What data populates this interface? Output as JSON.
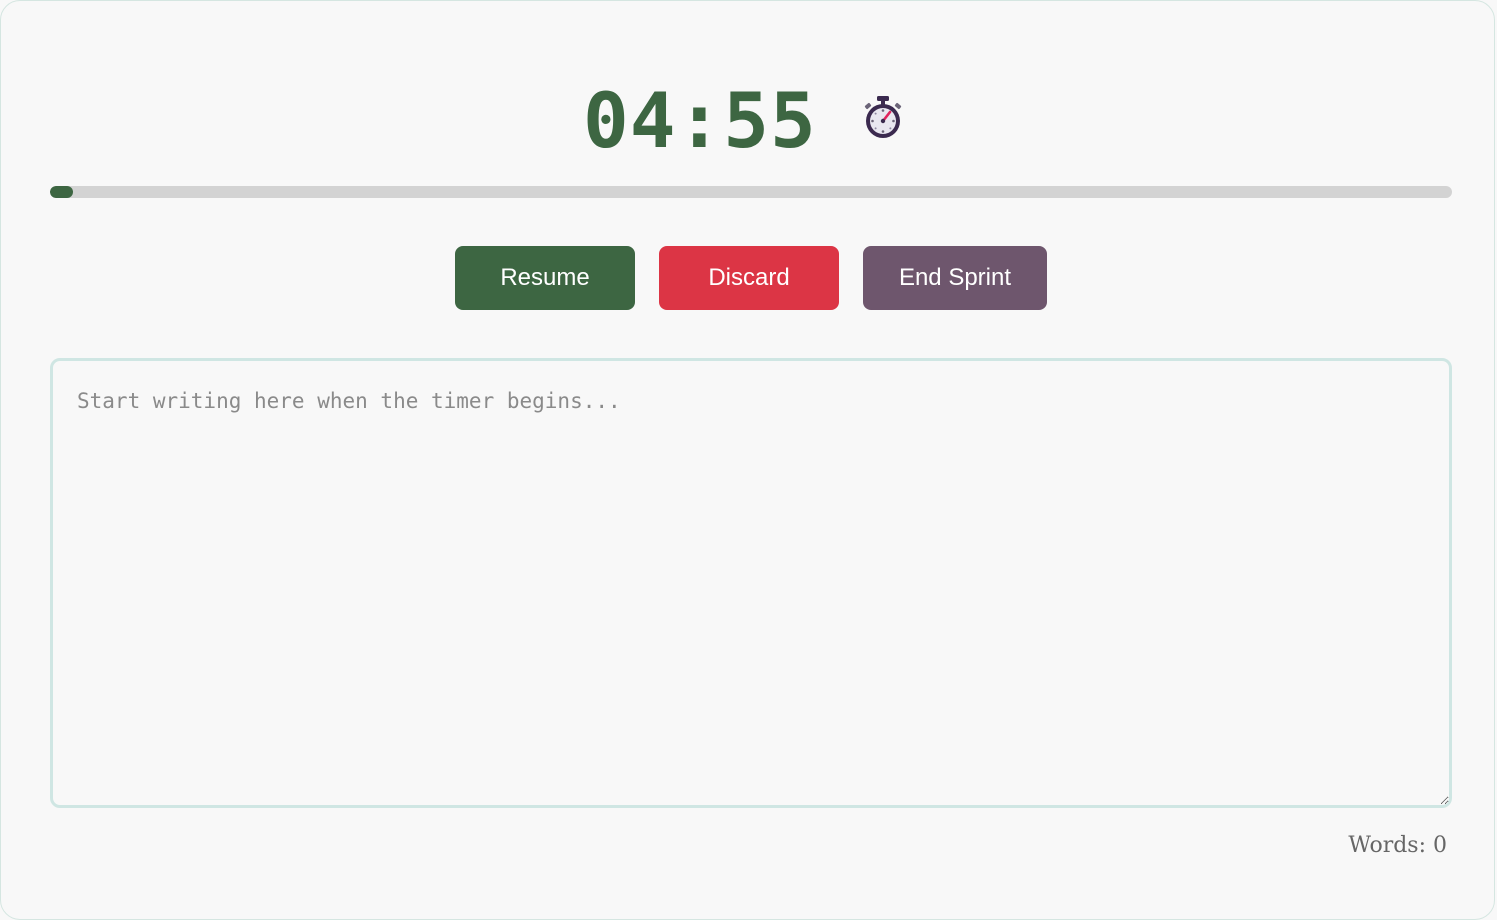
{
  "timer": {
    "display": "04:55",
    "icon": "stopwatch-icon"
  },
  "progress": {
    "fraction": 0.0167
  },
  "buttons": {
    "resume_label": "Resume",
    "discard_label": "Discard",
    "end_label": "End Sprint"
  },
  "editor": {
    "placeholder": "Start writing here when the timer begins...",
    "value": ""
  },
  "stats": {
    "words_label": "Words: 0"
  },
  "colors": {
    "accent_green": "#3d6642",
    "danger_red": "#dc3545",
    "end_purple": "#6e566d",
    "track_gray": "#d3d3d3",
    "editor_border": "#cfe6e3"
  }
}
